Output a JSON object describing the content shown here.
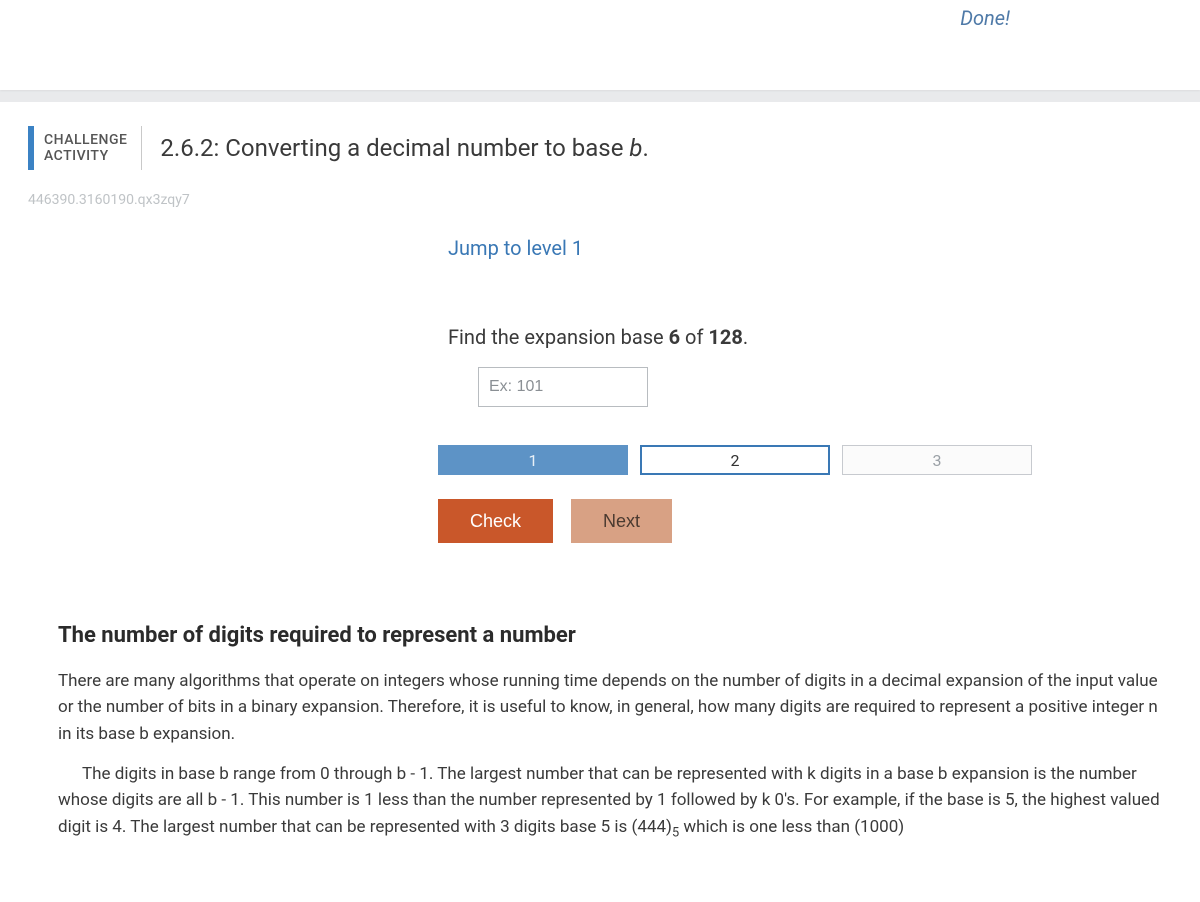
{
  "top": {
    "done": "Done!"
  },
  "challenge": {
    "tag_line1": "CHALLENGE",
    "tag_line2": "ACTIVITY",
    "number": "2.6.2:",
    "title_text": "Converting a decimal number to base ",
    "title_var": "b",
    "title_suffix": "."
  },
  "tracking": "446390.3160190.qx3zqy7",
  "activity": {
    "jump_label": "Jump to level 1",
    "prompt_prefix": "Find the expansion base ",
    "prompt_base": "6",
    "prompt_mid": " of ",
    "prompt_value": "128",
    "prompt_suffix": ".",
    "input_placeholder": "Ex: 101",
    "steps": [
      "1",
      "2",
      "3"
    ],
    "check_label": "Check",
    "next_label": "Next"
  },
  "section": {
    "heading": "The number of digits required to represent a number",
    "para1": "There are many algorithms that operate on integers whose running time depends on the number of digits in a decimal expansion of the input value or the number of bits in a binary expansion. Therefore, it is useful to know, in general, how many digits are required to represent a positive integer n in its base b expansion.",
    "para2_a": "The digits in base b range from 0 through b - 1. The largest number that can be represented with k digits in a base b expansion is the number whose digits are all b - 1. This number is 1 less than the number represented by 1 followed by k 0's. For example, if the base is 5, the highest valued digit is 4. The largest number that can be represented with 3 digits base 5 is (444)",
    "para2_sub": "5",
    "para2_b": " which is one less than (1000)"
  }
}
